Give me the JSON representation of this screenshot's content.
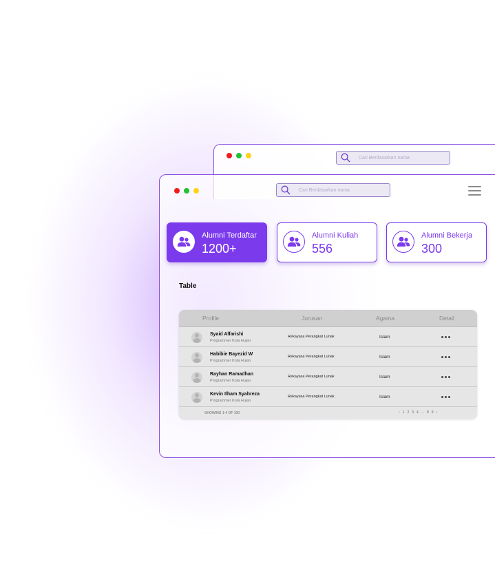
{
  "back_window": {
    "search": {
      "placeholder": "Cari Berdasarkan nama"
    }
  },
  "front_window": {
    "search": {
      "placeholder": "Cari Berdasarkan nama"
    },
    "cards": [
      {
        "title": "Alumni Terdaftar",
        "value": "1200+"
      },
      {
        "title": "Alumni Kuliah",
        "value": "556"
      },
      {
        "title": "Alumni Bekerja",
        "value": "300"
      }
    ],
    "section_title": "Table",
    "table": {
      "headers": [
        "Profile",
        "Jurusan",
        "Agama",
        "Detail"
      ],
      "rows": [
        {
          "name": "Syaid Alfarishi",
          "subtitle": "Programmer Kota Hujan",
          "jurusan": "Rekayasa Perangkat Lunak",
          "agama": "Islam"
        },
        {
          "name": "Habibie Bayezid W",
          "subtitle": "Programmer Kota Hujan",
          "jurusan": "Rekayasa Perangkat Lunak",
          "agama": "Islam"
        },
        {
          "name": "Rayhan Ramadhan",
          "subtitle": "Programmer Kota Hujan",
          "jurusan": "Rekayasa Perangkat Lunak",
          "agama": "Islam"
        },
        {
          "name": "Kevin Ilham Syahreza",
          "subtitle": "Programmer Kota Hujan",
          "jurusan": "Rekayasa Perangkat Lunak",
          "agama": "Islam"
        }
      ],
      "footer": "SHOWING 1-4 OF 100",
      "pagination": [
        "‹",
        "1",
        "2",
        "3",
        "4",
        "...",
        "8",
        "9",
        "›"
      ]
    }
  },
  "colors": {
    "accent": "#7c3aed",
    "dot_red": "#ee1c1c",
    "dot_green": "#22c231",
    "dot_yellow": "#ffd21a"
  },
  "icons": {
    "window_controls": "traffic-light-dots",
    "search": "search-icon",
    "menu": "hamburger-menu-icon",
    "card": "users-icon",
    "avatar": "user-avatar-icon",
    "detail": "more-horizontal-icon"
  }
}
